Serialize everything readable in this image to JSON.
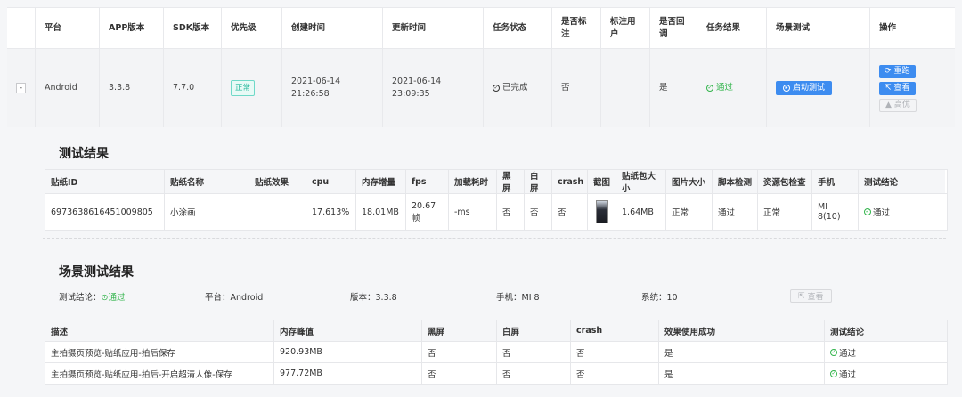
{
  "main_table": {
    "headers": [
      "平台",
      "APP版本",
      "SDK版本",
      "优先级",
      "创建时间",
      "更新时间",
      "任务状态",
      "是否标注",
      "标注用户",
      "是否回调",
      "任务结果",
      "场景测试",
      "操作"
    ],
    "row": {
      "expand_symbol": "-",
      "platform": "Android",
      "app_version": "3.3.8",
      "sdk_version": "7.7.0",
      "priority": "正常",
      "created_date": "2021-06-14",
      "created_time": "21:26:58",
      "updated_date": "2021-06-14",
      "updated_time": "23:09:35",
      "task_status": "已完成",
      "is_labeled": "否",
      "label_user": "",
      "is_callback": "是",
      "task_result": "通过",
      "scene_test_button": "启动测试",
      "actions": {
        "rerun": "重跑",
        "view": "查看",
        "priority": "高优"
      }
    }
  },
  "test_results": {
    "title": "测试结果",
    "headers": [
      "贴纸ID",
      "贴纸名称",
      "贴纸效果",
      "cpu",
      "内存增量",
      "fps",
      "加载耗时",
      "黑屏",
      "白屏",
      "crash",
      "截图",
      "贴纸包大小",
      "图片大小",
      "脚本检测",
      "资源包检查",
      "手机",
      "测试结论"
    ],
    "row": [
      "6973638616451009805",
      "小涂画",
      "",
      "17.613%",
      "18.01MB",
      "20.67帧",
      "-ms",
      "否",
      "否",
      "否",
      "",
      "1.64MB",
      "正常",
      "通过",
      "正常",
      "MI 8(10)",
      "通过"
    ]
  },
  "scene_results": {
    "title": "场景测试结果",
    "summary": {
      "conclusion_label": "测试结论：",
      "conclusion_value": "通过",
      "platform": "平台：Android",
      "version": "版本：3.3.8",
      "phone": "手机：MI 8",
      "system": "系统：10",
      "view_button": "查看"
    },
    "headers": [
      "描述",
      "内存峰值",
      "黑屏",
      "白屏",
      "crash",
      "效果使用成功",
      "测试结论"
    ],
    "rows": [
      [
        "主拍摄页预览-贴纸应用-拍后保存",
        "920.93MB",
        "否",
        "否",
        "否",
        "是",
        "通过"
      ],
      [
        "主拍摄页预览-贴纸应用-拍后-开启超清人像-保存",
        "977.72MB",
        "否",
        "否",
        "否",
        "是",
        "通过"
      ]
    ]
  },
  "colors": {
    "accent": "#3d8cf0",
    "success": "#31b44b",
    "tag": "#25b89c"
  }
}
